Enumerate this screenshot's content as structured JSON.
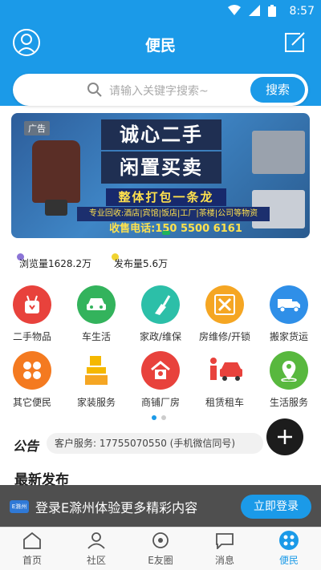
{
  "status_bar": {
    "time": "8:57"
  },
  "header": {
    "title": "便民"
  },
  "search": {
    "placeholder": "请输入关键字搜索~",
    "button": "搜索"
  },
  "banner": {
    "ad_tag": "广告",
    "line1": "诚心二手",
    "line2": "闲置买卖",
    "line3": "整体打包一条龙",
    "line4": "专业回收:酒店|宾馆|饭店|工厂|茶楼|公司等物资",
    "line5": "收售电话:150 5500 6161"
  },
  "stats": {
    "views": "浏览量1628.2万",
    "posts": "发布量5.6万"
  },
  "categories": [
    {
      "label": "二手物品",
      "icon": "bag-icon",
      "color": "#e8423c"
    },
    {
      "label": "车生活",
      "icon": "car-icon",
      "color": "#33b35c"
    },
    {
      "label": "家政/维保",
      "icon": "broom-icon",
      "color": "#2cbfa8"
    },
    {
      "label": "房维修/开锁",
      "icon": "tools-icon",
      "color": "#f5a623"
    },
    {
      "label": "搬家货运",
      "icon": "truck-icon",
      "color": "#2f8fe8"
    },
    {
      "label": "其它便民",
      "icon": "grid-icon",
      "color": "#f47a20"
    },
    {
      "label": "家装服务",
      "icon": "furniture-icon",
      "color": "#ffffff"
    },
    {
      "label": "商铺厂房",
      "icon": "shop-icon",
      "color": "#e8423c"
    },
    {
      "label": "租赁租车",
      "icon": "rent-car-icon",
      "color": "#ffffff"
    },
    {
      "label": "生活服务",
      "icon": "location-icon",
      "color": "#58b83e"
    }
  ],
  "notice": {
    "title": "公告",
    "text": "客户服务: 17755070550 (手机微信同号)"
  },
  "latest": {
    "title": "最新发布"
  },
  "login_bar": {
    "logo": "E滁州",
    "text": "登录E滁州体验更多精彩内容",
    "button": "立即登录"
  },
  "tabs": [
    {
      "label": "首页",
      "icon": "home-icon"
    },
    {
      "label": "社区",
      "icon": "community-icon"
    },
    {
      "label": "E友圈",
      "icon": "circle-icon"
    },
    {
      "label": "消息",
      "icon": "message-icon"
    },
    {
      "label": "便民",
      "icon": "convenience-icon",
      "active": true
    }
  ],
  "colors": {
    "primary": "#1b9ae8",
    "fab": "#1c1c1c"
  }
}
